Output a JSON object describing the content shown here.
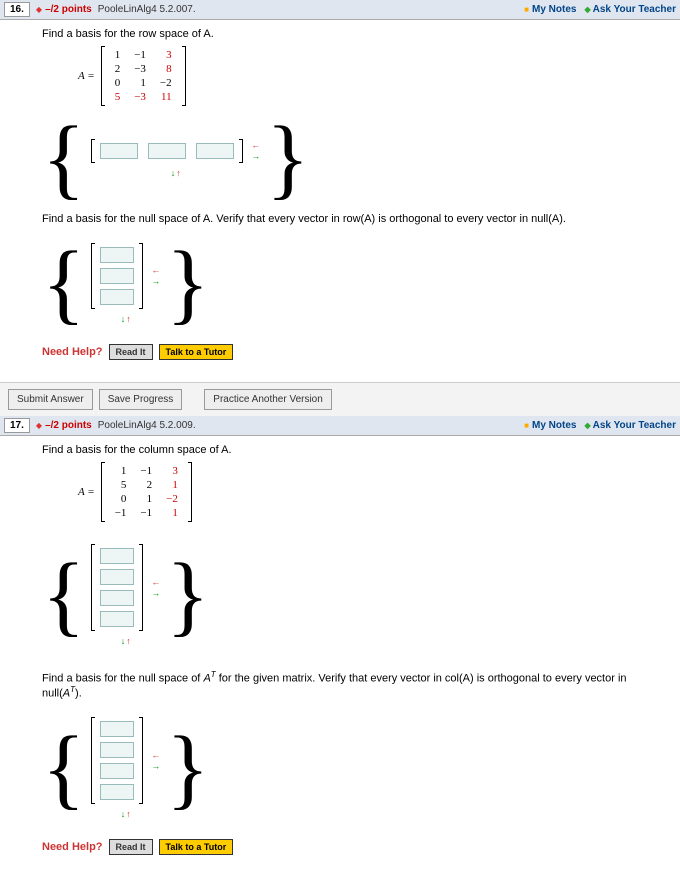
{
  "q16": {
    "number": "16.",
    "points": "–/2 points",
    "source": "PooleLinAlg4 5.2.007.",
    "prompt1": "Find a basis for the row space of A.",
    "matrix": {
      "label": "A =",
      "r1c1": "1",
      "r1c2": "−1",
      "r1c3": "3",
      "r2c1": "2",
      "r2c2": "−3",
      "r2c3": "8",
      "r3c1": "0",
      "r3c2": "1",
      "r3c3": "−2",
      "r4c1": "5",
      "r4c2": "−3",
      "r4c3": "11"
    },
    "prompt2": "Find a basis for the null space of A. Verify that every vector in row(A) is orthogonal to every vector in null(A).",
    "need_help": "Need Help?",
    "read_it": "Read It",
    "tutor": "Talk to a Tutor"
  },
  "actions": {
    "submit": "Submit Answer",
    "save": "Save Progress",
    "practice": "Practice Another Version"
  },
  "header_links": {
    "my_notes": "My Notes",
    "ask_teacher": "Ask Your Teacher"
  },
  "q17": {
    "number": "17.",
    "points": "–/2 points",
    "source": "PooleLinAlg4 5.2.009.",
    "prompt1": "Find a basis for the column space of A.",
    "matrix": {
      "label": "A =",
      "r1c1": "1",
      "r1c2": "−1",
      "r1c3": "3",
      "r2c1": "5",
      "r2c2": "2",
      "r2c3": "1",
      "r3c1": "0",
      "r3c2": "1",
      "r3c3": "−2",
      "r4c1": "−1",
      "r4c2": "−1",
      "r4c3": "1"
    },
    "prompt2_a": "Find a basis for the null space of ",
    "prompt2_b": " for the given matrix. Verify that every vector in col(A) is orthogonal to every vector in null(",
    "prompt2_c": ").",
    "need_help": "Need Help?",
    "read_it": "Read It",
    "tutor": "Talk to a Tutor"
  }
}
